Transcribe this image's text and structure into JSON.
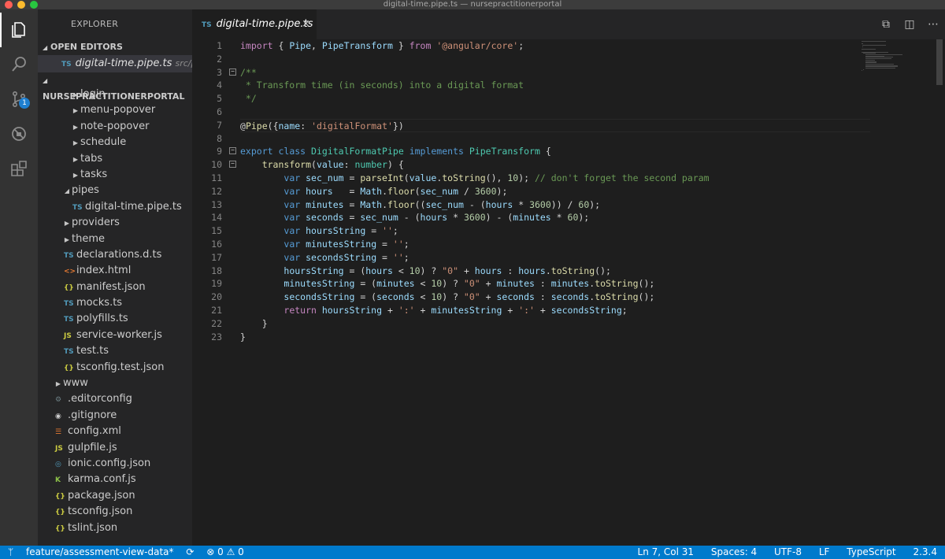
{
  "window": {
    "title": "digital-time.pipe.ts — nursepractitionerportal"
  },
  "activity": {
    "scm_badge": "1"
  },
  "sidebar": {
    "title": "EXPLORER",
    "open_editors_label": "OPEN EDITORS",
    "open_editor": {
      "icon": "TS",
      "name": "digital-time.pipe.ts",
      "path": "src/p..."
    },
    "project_label": "NURSEPRACTITIONERPORTAL",
    "tree": [
      {
        "label": "login",
        "kind": "folder",
        "indent": 2,
        "icon": ""
      },
      {
        "label": "menu-popover",
        "kind": "folder",
        "indent": 2,
        "icon": ""
      },
      {
        "label": "note-popover",
        "kind": "folder",
        "indent": 2,
        "icon": ""
      },
      {
        "label": "schedule",
        "kind": "folder",
        "indent": 2,
        "icon": ""
      },
      {
        "label": "tabs",
        "kind": "folder",
        "indent": 2,
        "icon": ""
      },
      {
        "label": "tasks",
        "kind": "folder",
        "indent": 2,
        "icon": ""
      },
      {
        "label": "pipes",
        "kind": "folder-open",
        "indent": 1,
        "icon": ""
      },
      {
        "label": "digital-time.pipe.ts",
        "kind": "file",
        "indent": 2,
        "icon": "TS"
      },
      {
        "label": "providers",
        "kind": "folder",
        "indent": 1,
        "icon": ""
      },
      {
        "label": "theme",
        "kind": "folder",
        "indent": 1,
        "icon": ""
      },
      {
        "label": "declarations.d.ts",
        "kind": "file",
        "indent": 1,
        "icon": "TS"
      },
      {
        "label": "index.html",
        "kind": "file",
        "indent": 1,
        "icon": "<>"
      },
      {
        "label": "manifest.json",
        "kind": "file",
        "indent": 1,
        "icon": "{}"
      },
      {
        "label": "mocks.ts",
        "kind": "file",
        "indent": 1,
        "icon": "TS"
      },
      {
        "label": "polyfills.ts",
        "kind": "file",
        "indent": 1,
        "icon": "TS"
      },
      {
        "label": "service-worker.js",
        "kind": "file",
        "indent": 1,
        "icon": "JS"
      },
      {
        "label": "test.ts",
        "kind": "file",
        "indent": 1,
        "icon": "TS"
      },
      {
        "label": "tsconfig.test.json",
        "kind": "file",
        "indent": 1,
        "icon": "{}"
      },
      {
        "label": "www",
        "kind": "folder",
        "indent": 0,
        "icon": ""
      },
      {
        "label": ".editorconfig",
        "kind": "file",
        "indent": 0,
        "icon": "⚙"
      },
      {
        "label": ".gitignore",
        "kind": "file",
        "indent": 0,
        "icon": "◉"
      },
      {
        "label": "config.xml",
        "kind": "file",
        "indent": 0,
        "icon": "☰"
      },
      {
        "label": "gulpfile.js",
        "kind": "file",
        "indent": 0,
        "icon": "JS"
      },
      {
        "label": "ionic.config.json",
        "kind": "file",
        "indent": 0,
        "icon": "◎"
      },
      {
        "label": "karma.conf.js",
        "kind": "file",
        "indent": 0,
        "icon": "K"
      },
      {
        "label": "package.json",
        "kind": "file",
        "indent": 0,
        "icon": "{}"
      },
      {
        "label": "tsconfig.json",
        "kind": "file",
        "indent": 0,
        "icon": "{}"
      },
      {
        "label": "tslint.json",
        "kind": "file",
        "indent": 0,
        "icon": "{}"
      }
    ]
  },
  "tab": {
    "icon": "TS",
    "name": "digital-time.pipe.ts",
    "close": "×"
  },
  "editor": {
    "current_line": 7,
    "lines": [
      [
        [
          "kw2",
          "import"
        ],
        [
          "p",
          " { "
        ],
        [
          "var",
          "Pipe"
        ],
        [
          "p",
          ", "
        ],
        [
          "var",
          "PipeTransform"
        ],
        [
          "p",
          " } "
        ],
        [
          "kw2",
          "from"
        ],
        [
          "p",
          " "
        ],
        [
          "str",
          "'@angular/core'"
        ],
        [
          "p",
          ";"
        ]
      ],
      [],
      [
        [
          "cmt",
          "/**"
        ]
      ],
      [
        [
          "cmt",
          " * Transform time (in seconds) into a digital format"
        ]
      ],
      [
        [
          "cmt",
          " */"
        ]
      ],
      [],
      [
        [
          "p",
          "@"
        ],
        [
          "dec",
          "Pipe"
        ],
        [
          "p",
          "({"
        ],
        [
          "var",
          "name"
        ],
        [
          "p",
          ": "
        ],
        [
          "str",
          "'digitalFormat'"
        ],
        [
          "p",
          "})"
        ]
      ],
      [],
      [
        [
          "kw",
          "export"
        ],
        [
          "p",
          " "
        ],
        [
          "kw",
          "class"
        ],
        [
          "p",
          " "
        ],
        [
          "cls",
          "DigitalFormatPipe"
        ],
        [
          "p",
          " "
        ],
        [
          "kw",
          "implements"
        ],
        [
          "p",
          " "
        ],
        [
          "cls",
          "PipeTransform"
        ],
        [
          "p",
          " {"
        ]
      ],
      [
        [
          "p",
          "    "
        ],
        [
          "fn",
          "transform"
        ],
        [
          "p",
          "("
        ],
        [
          "var",
          "value"
        ],
        [
          "p",
          ": "
        ],
        [
          "cls",
          "number"
        ],
        [
          "p",
          ") {"
        ]
      ],
      [
        [
          "p",
          "        "
        ],
        [
          "kw",
          "var"
        ],
        [
          "p",
          " "
        ],
        [
          "var",
          "sec_num"
        ],
        [
          "p",
          " = "
        ],
        [
          "fn",
          "parseInt"
        ],
        [
          "p",
          "("
        ],
        [
          "var",
          "value"
        ],
        [
          "p",
          "."
        ],
        [
          "fn",
          "toString"
        ],
        [
          "p",
          "(), "
        ],
        [
          "num",
          "10"
        ],
        [
          "p",
          "); "
        ],
        [
          "cmt",
          "// don't forget the second param"
        ]
      ],
      [
        [
          "p",
          "        "
        ],
        [
          "kw",
          "var"
        ],
        [
          "p",
          " "
        ],
        [
          "var",
          "hours"
        ],
        [
          "p",
          "   = "
        ],
        [
          "var",
          "Math"
        ],
        [
          "p",
          "."
        ],
        [
          "fn",
          "floor"
        ],
        [
          "p",
          "("
        ],
        [
          "var",
          "sec_num"
        ],
        [
          "p",
          " / "
        ],
        [
          "num",
          "3600"
        ],
        [
          "p",
          ");"
        ]
      ],
      [
        [
          "p",
          "        "
        ],
        [
          "kw",
          "var"
        ],
        [
          "p",
          " "
        ],
        [
          "var",
          "minutes"
        ],
        [
          "p",
          " = "
        ],
        [
          "var",
          "Math"
        ],
        [
          "p",
          "."
        ],
        [
          "fn",
          "floor"
        ],
        [
          "p",
          "(("
        ],
        [
          "var",
          "sec_num"
        ],
        [
          "p",
          " - ("
        ],
        [
          "var",
          "hours"
        ],
        [
          "p",
          " * "
        ],
        [
          "num",
          "3600"
        ],
        [
          "p",
          ")) / "
        ],
        [
          "num",
          "60"
        ],
        [
          "p",
          ");"
        ]
      ],
      [
        [
          "p",
          "        "
        ],
        [
          "kw",
          "var"
        ],
        [
          "p",
          " "
        ],
        [
          "var",
          "seconds"
        ],
        [
          "p",
          " = "
        ],
        [
          "var",
          "sec_num"
        ],
        [
          "p",
          " - ("
        ],
        [
          "var",
          "hours"
        ],
        [
          "p",
          " * "
        ],
        [
          "num",
          "3600"
        ],
        [
          "p",
          ") - ("
        ],
        [
          "var",
          "minutes"
        ],
        [
          "p",
          " * "
        ],
        [
          "num",
          "60"
        ],
        [
          "p",
          ");"
        ]
      ],
      [
        [
          "p",
          "        "
        ],
        [
          "kw",
          "var"
        ],
        [
          "p",
          " "
        ],
        [
          "var",
          "hoursString"
        ],
        [
          "p",
          " = "
        ],
        [
          "str",
          "''"
        ],
        [
          "p",
          ";"
        ]
      ],
      [
        [
          "p",
          "        "
        ],
        [
          "kw",
          "var"
        ],
        [
          "p",
          " "
        ],
        [
          "var",
          "minutesString"
        ],
        [
          "p",
          " = "
        ],
        [
          "str",
          "''"
        ],
        [
          "p",
          ";"
        ]
      ],
      [
        [
          "p",
          "        "
        ],
        [
          "kw",
          "var"
        ],
        [
          "p",
          " "
        ],
        [
          "var",
          "secondsString"
        ],
        [
          "p",
          " = "
        ],
        [
          "str",
          "''"
        ],
        [
          "p",
          ";"
        ]
      ],
      [
        [
          "p",
          "        "
        ],
        [
          "var",
          "hoursString"
        ],
        [
          "p",
          " = ("
        ],
        [
          "var",
          "hours"
        ],
        [
          "p",
          " < "
        ],
        [
          "num",
          "10"
        ],
        [
          "p",
          ") ? "
        ],
        [
          "str",
          "\"0\""
        ],
        [
          "p",
          " + "
        ],
        [
          "var",
          "hours"
        ],
        [
          "p",
          " : "
        ],
        [
          "var",
          "hours"
        ],
        [
          "p",
          "."
        ],
        [
          "fn",
          "toString"
        ],
        [
          "p",
          "();"
        ]
      ],
      [
        [
          "p",
          "        "
        ],
        [
          "var",
          "minutesString"
        ],
        [
          "p",
          " = ("
        ],
        [
          "var",
          "minutes"
        ],
        [
          "p",
          " < "
        ],
        [
          "num",
          "10"
        ],
        [
          "p",
          ") ? "
        ],
        [
          "str",
          "\"0\""
        ],
        [
          "p",
          " + "
        ],
        [
          "var",
          "minutes"
        ],
        [
          "p",
          " : "
        ],
        [
          "var",
          "minutes"
        ],
        [
          "p",
          "."
        ],
        [
          "fn",
          "toString"
        ],
        [
          "p",
          "();"
        ]
      ],
      [
        [
          "p",
          "        "
        ],
        [
          "var",
          "secondsString"
        ],
        [
          "p",
          " = ("
        ],
        [
          "var",
          "seconds"
        ],
        [
          "p",
          " < "
        ],
        [
          "num",
          "10"
        ],
        [
          "p",
          ") ? "
        ],
        [
          "str",
          "\"0\""
        ],
        [
          "p",
          " + "
        ],
        [
          "var",
          "seconds"
        ],
        [
          "p",
          " : "
        ],
        [
          "var",
          "seconds"
        ],
        [
          "p",
          "."
        ],
        [
          "fn",
          "toString"
        ],
        [
          "p",
          "();"
        ]
      ],
      [
        [
          "p",
          "        "
        ],
        [
          "kw2",
          "return"
        ],
        [
          "p",
          " "
        ],
        [
          "var",
          "hoursString"
        ],
        [
          "p",
          " + "
        ],
        [
          "str",
          "':'"
        ],
        [
          "p",
          " + "
        ],
        [
          "var",
          "minutesString"
        ],
        [
          "p",
          " + "
        ],
        [
          "str",
          "':'"
        ],
        [
          "p",
          " + "
        ],
        [
          "var",
          "secondsString"
        ],
        [
          "p",
          ";"
        ]
      ],
      [
        [
          "p",
          "    }"
        ]
      ],
      [
        [
          "p",
          "}"
        ]
      ]
    ],
    "fold_lines": [
      3,
      9,
      10
    ]
  },
  "statusbar": {
    "branch": "feature/assessment-view-data*",
    "sync": "⟳",
    "errors": "0",
    "warnings": "0",
    "position": "Ln 7, Col 31",
    "spaces": "Spaces: 4",
    "encoding": "UTF-8",
    "eol": "LF",
    "language": "TypeScript",
    "version": "2.3.4"
  },
  "colors": {
    "accent": "#007acc",
    "badge": "#1e7fd0"
  }
}
